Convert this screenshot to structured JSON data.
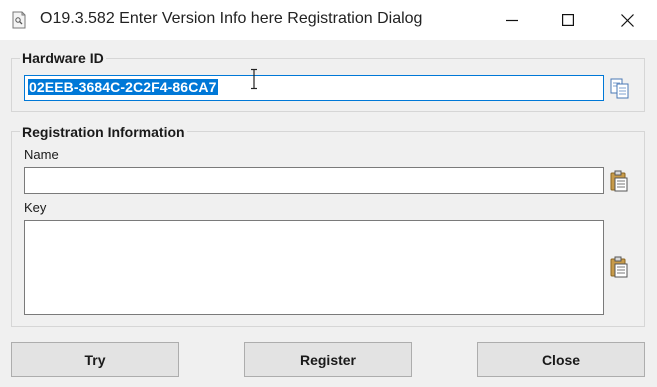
{
  "window": {
    "title": "O19.3.582 Enter Version Info here Registration Dialog",
    "app_icon": "app-icon",
    "controls": [
      "minimize-icon",
      "maximize-icon",
      "close-icon"
    ]
  },
  "hardware": {
    "group_title": "Hardware ID",
    "hardware_id": "02EEB-3684C-2C2F4-86CA7",
    "copy_icon": "copy-icon"
  },
  "registration": {
    "group_title": "Registration Information",
    "name_label": "Name",
    "name_value": "",
    "key_label": "Key",
    "key_value": "",
    "paste_icon": "paste-icon"
  },
  "buttons": {
    "try": "Try",
    "register": "Register",
    "close": "Close"
  },
  "colors": {
    "selection": "#0078d7",
    "window_bg": "#f0f0f0",
    "button_bg": "#e3e3e3"
  }
}
